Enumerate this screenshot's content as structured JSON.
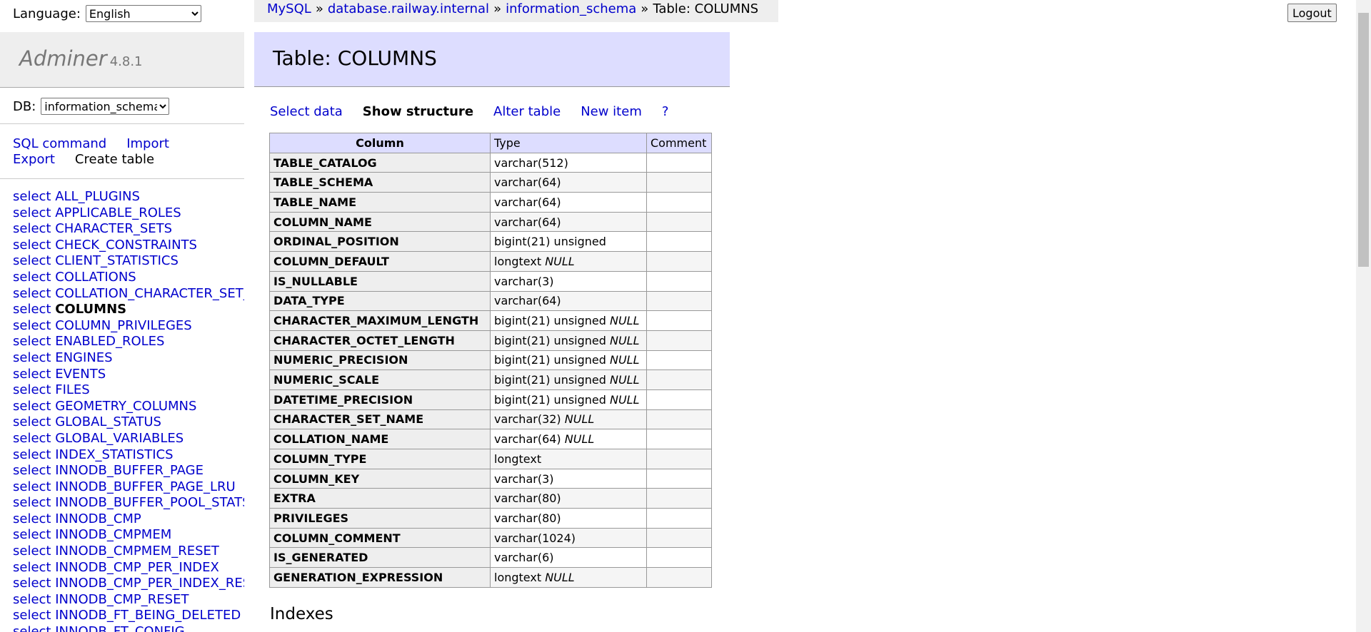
{
  "sidebar": {
    "language_label": "Language:",
    "language_selected": "English",
    "brand": "Adminer",
    "version": "4.8.1",
    "db_label": "DB:",
    "db_selected": "information_schema",
    "commands": {
      "sql_command": "SQL command",
      "import": "Import",
      "export": "Export",
      "create_table": "Create table"
    },
    "select_prefix": "select",
    "tables": [
      "ALL_PLUGINS",
      "APPLICABLE_ROLES",
      "CHARACTER_SETS",
      "CHECK_CONSTRAINTS",
      "CLIENT_STATISTICS",
      "COLLATIONS",
      "COLLATION_CHARACTER_SET_APPLICABILITY",
      "COLUMNS",
      "COLUMN_PRIVILEGES",
      "ENABLED_ROLES",
      "ENGINES",
      "EVENTS",
      "FILES",
      "GEOMETRY_COLUMNS",
      "GLOBAL_STATUS",
      "GLOBAL_VARIABLES",
      "INDEX_STATISTICS",
      "INNODB_BUFFER_PAGE",
      "INNODB_BUFFER_PAGE_LRU",
      "INNODB_BUFFER_POOL_STATS",
      "INNODB_CMP",
      "INNODB_CMPMEM",
      "INNODB_CMPMEM_RESET",
      "INNODB_CMP_PER_INDEX",
      "INNODB_CMP_PER_INDEX_RESET",
      "INNODB_CMP_RESET",
      "INNODB_FT_BEING_DELETED",
      "INNODB_FT_CONFIG"
    ],
    "active_table": "COLUMNS"
  },
  "breadcrumb": {
    "items": [
      "MySQL",
      "database.railway.internal",
      "information_schema"
    ],
    "separator": "»",
    "current": "Table: COLUMNS"
  },
  "logout_label": "Logout",
  "page_title": "Table: COLUMNS",
  "actions": {
    "select_data": "Select data",
    "show_structure": "Show structure",
    "alter_table": "Alter table",
    "new_item": "New item",
    "help": "?"
  },
  "structure": {
    "headers": [
      "Column",
      "Type",
      "Comment"
    ],
    "rows": [
      {
        "column": "TABLE_CATALOG",
        "type": "varchar(512)",
        "null": ""
      },
      {
        "column": "TABLE_SCHEMA",
        "type": "varchar(64)",
        "null": ""
      },
      {
        "column": "TABLE_NAME",
        "type": "varchar(64)",
        "null": ""
      },
      {
        "column": "COLUMN_NAME",
        "type": "varchar(64)",
        "null": ""
      },
      {
        "column": "ORDINAL_POSITION",
        "type": "bigint(21) unsigned",
        "null": ""
      },
      {
        "column": "COLUMN_DEFAULT",
        "type": "longtext",
        "null": "NULL"
      },
      {
        "column": "IS_NULLABLE",
        "type": "varchar(3)",
        "null": ""
      },
      {
        "column": "DATA_TYPE",
        "type": "varchar(64)",
        "null": ""
      },
      {
        "column": "CHARACTER_MAXIMUM_LENGTH",
        "type": "bigint(21) unsigned",
        "null": "NULL"
      },
      {
        "column": "CHARACTER_OCTET_LENGTH",
        "type": "bigint(21) unsigned",
        "null": "NULL"
      },
      {
        "column": "NUMERIC_PRECISION",
        "type": "bigint(21) unsigned",
        "null": "NULL"
      },
      {
        "column": "NUMERIC_SCALE",
        "type": "bigint(21) unsigned",
        "null": "NULL"
      },
      {
        "column": "DATETIME_PRECISION",
        "type": "bigint(21) unsigned",
        "null": "NULL"
      },
      {
        "column": "CHARACTER_SET_NAME",
        "type": "varchar(32)",
        "null": "NULL"
      },
      {
        "column": "COLLATION_NAME",
        "type": "varchar(64)",
        "null": "NULL"
      },
      {
        "column": "COLUMN_TYPE",
        "type": "longtext",
        "null": ""
      },
      {
        "column": "COLUMN_KEY",
        "type": "varchar(3)",
        "null": ""
      },
      {
        "column": "EXTRA",
        "type": "varchar(80)",
        "null": ""
      },
      {
        "column": "PRIVILEGES",
        "type": "varchar(80)",
        "null": ""
      },
      {
        "column": "COLUMN_COMMENT",
        "type": "varchar(1024)",
        "null": ""
      },
      {
        "column": "IS_GENERATED",
        "type": "varchar(6)",
        "null": ""
      },
      {
        "column": "GENERATION_EXPRESSION",
        "type": "longtext",
        "null": "NULL"
      }
    ]
  },
  "indexes_title": "Indexes"
}
